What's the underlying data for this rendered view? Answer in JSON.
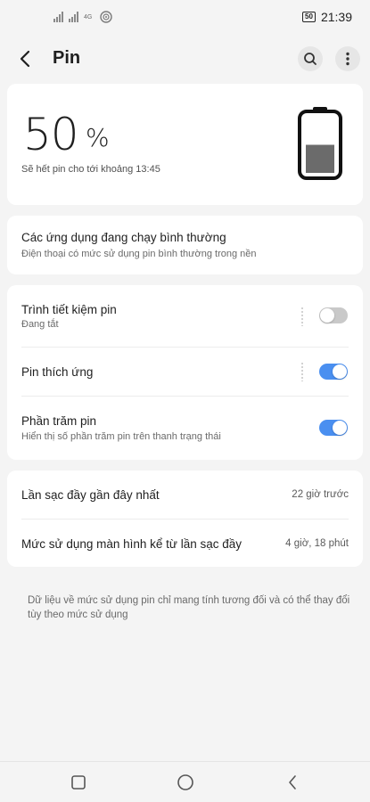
{
  "status_bar": {
    "network_label": "4G",
    "battery_level": "50",
    "time": "21:39"
  },
  "header": {
    "title": "Pin",
    "back_icon": "chevron-left-icon",
    "search_icon": "search-icon",
    "more_icon": "more-vertical-icon"
  },
  "battery": {
    "percent": "50",
    "percent_sign": "%",
    "level_fraction": 0.5,
    "estimate": "Sẽ hết pin cho tới khoảng 13:45"
  },
  "apps": {
    "title": "Các ứng dụng đang chạy bình thường",
    "subtitle": "Điện thoại có mức sử dụng pin bình thường trong nền"
  },
  "settings": [
    {
      "title": "Trình tiết kiệm pin",
      "subtitle": "Đang tắt",
      "enabled": false
    },
    {
      "title": "Pin thích ứng",
      "subtitle": "",
      "enabled": true
    },
    {
      "title": "Phần trăm pin",
      "subtitle": "Hiển thị số phần trăm pin trên thanh trạng thái",
      "enabled": true
    }
  ],
  "usage": [
    {
      "label": "Lần sạc đầy gần đây nhất",
      "value": "22 giờ trước"
    },
    {
      "label": "Mức sử dụng màn hình kể từ lần sạc đầy",
      "value": "4 giờ, 18 phút"
    }
  ],
  "footnote": "Dữ liệu về mức sử dụng pin chỉ mang tính tương đối và có thể thay đổi tùy theo mức sử dụng",
  "colors": {
    "accent": "#4a8ff0",
    "toggle_off": "#c9c9c9",
    "background": "#f4f4f4",
    "battery_fill": "#6b6b6b"
  }
}
